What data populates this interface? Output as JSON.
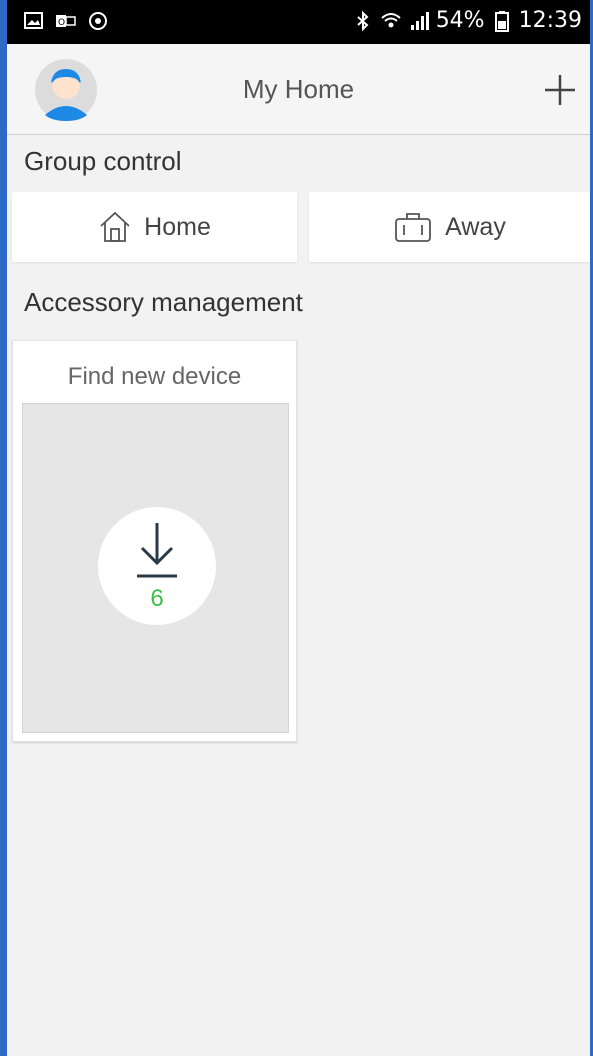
{
  "status_bar": {
    "battery": "54%",
    "time": "12:39",
    "icons_left": [
      "image-icon",
      "outlook-icon",
      "sync-icon"
    ],
    "icons_right": [
      "bluetooth-icon",
      "wifi-icon",
      "signal-icon",
      "battery-icon"
    ]
  },
  "header": {
    "title": "My Home",
    "avatar": "user-avatar-icon",
    "add": "plus-icon"
  },
  "group_control": {
    "title": "Group control",
    "buttons": [
      {
        "label": "Home",
        "icon": "house-icon"
      },
      {
        "label": "Away",
        "icon": "suitcase-icon"
      }
    ]
  },
  "accessory": {
    "title": "Accessory management",
    "card": {
      "title": "Find new device",
      "count": "6",
      "icon": "download-icon",
      "count_color": "#3fbf4a"
    }
  }
}
